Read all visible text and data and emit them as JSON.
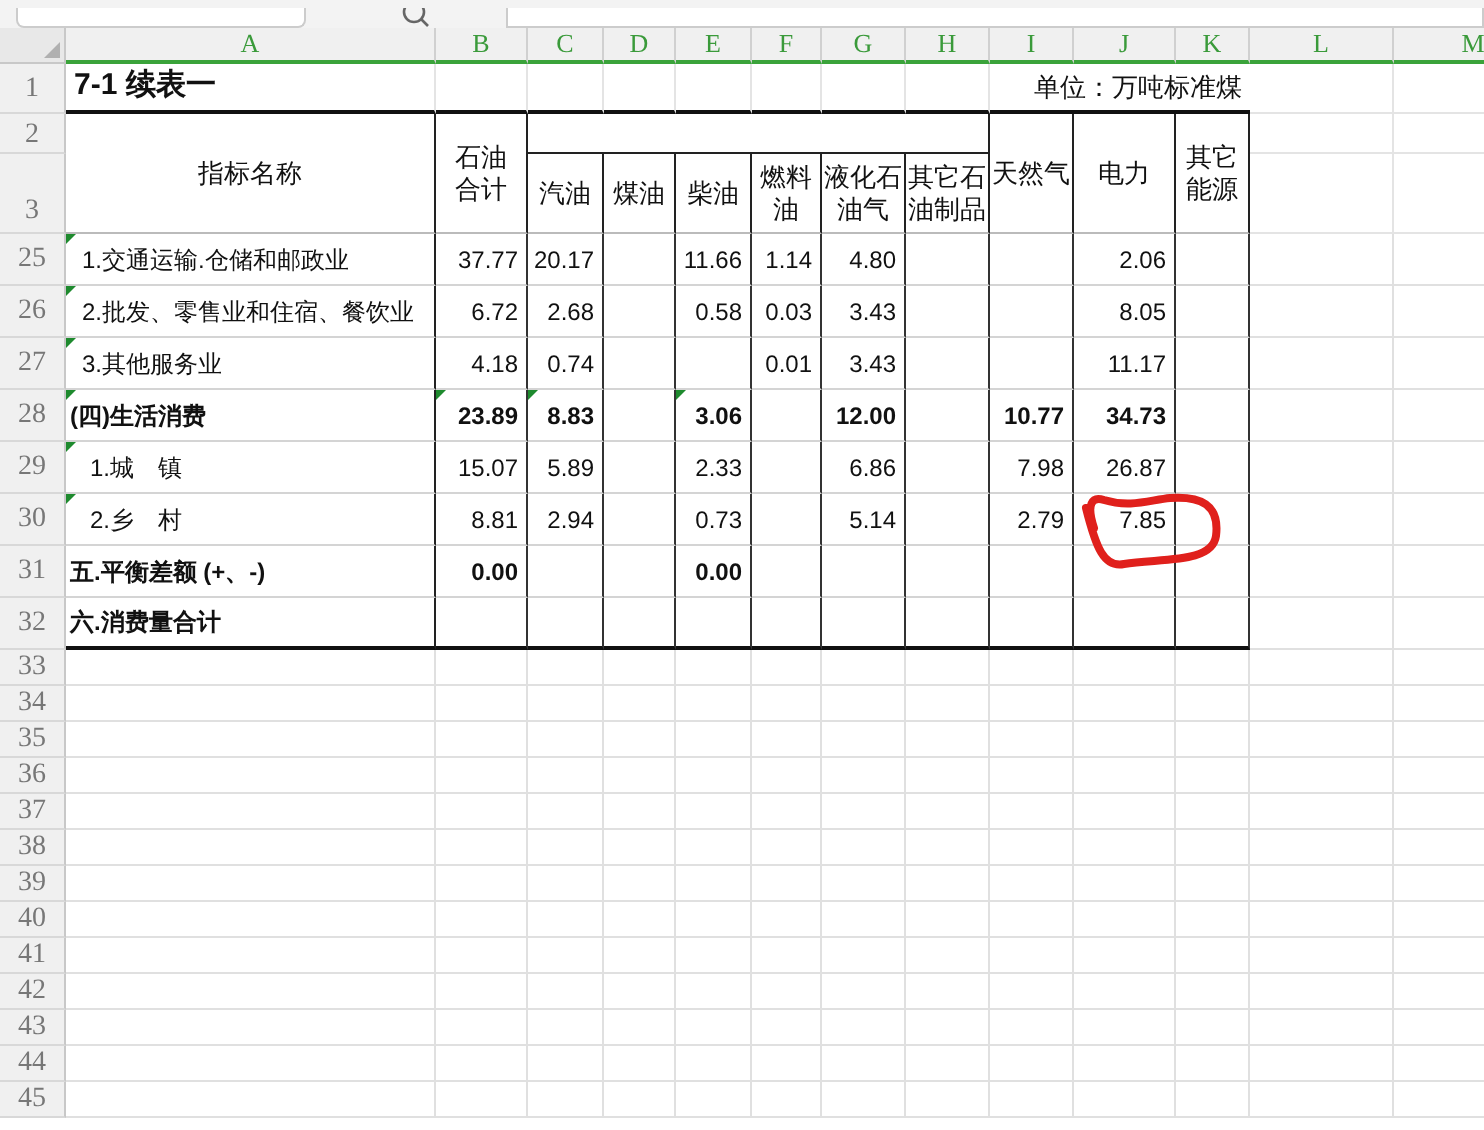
{
  "columns": [
    {
      "letter": "A"
    },
    {
      "letter": "B"
    },
    {
      "letter": "C"
    },
    {
      "letter": "D"
    },
    {
      "letter": "E"
    },
    {
      "letter": "F"
    },
    {
      "letter": "G"
    },
    {
      "letter": "H"
    },
    {
      "letter": "I"
    },
    {
      "letter": "J"
    },
    {
      "letter": "K"
    },
    {
      "letter": "L"
    },
    {
      "letter": "M"
    }
  ],
  "title": {
    "row": "1",
    "text": "7-1  续表一",
    "unit": "单位：万吨标准煤"
  },
  "header": {
    "rows": [
      "2",
      "3"
    ],
    "name": "指标名称",
    "total": "石油合计",
    "petroleum": [
      "汽油",
      "煤油",
      "柴油",
      "燃料油",
      "液化石油气",
      "其它石油制品"
    ],
    "others": [
      "天然气",
      "电力",
      "其它能源"
    ]
  },
  "rows": [
    {
      "row": "25",
      "kind": "item",
      "label": "1.交通运输.仓储和邮政业",
      "label_flagged": true,
      "values": {
        "B": "37.77",
        "C": "20.17",
        "E": "11.66",
        "F": "1.14",
        "G": "4.80",
        "J": "2.06"
      }
    },
    {
      "row": "26",
      "kind": "item",
      "label": "2.批发、零售业和住宿、餐饮业",
      "label_flagged": true,
      "values": {
        "B": "6.72",
        "C": "2.68",
        "E": "0.58",
        "F": "0.03",
        "G": "3.43",
        "J": "8.05"
      }
    },
    {
      "row": "27",
      "kind": "item",
      "label": "3.其他服务业",
      "label_flagged": true,
      "values": {
        "B": "4.18",
        "C": "0.74",
        "F": "0.01",
        "G": "3.43",
        "J": "11.17"
      }
    },
    {
      "row": "28",
      "kind": "group",
      "label": "(四)生活消费",
      "label_flagged": true,
      "values": {
        "B": "23.89",
        "C": "8.83",
        "E": "3.06",
        "G": "12.00",
        "I": "10.77",
        "J": "34.73"
      },
      "flagged_values": {
        "B": true,
        "C": true,
        "E": true
      }
    },
    {
      "row": "29",
      "kind": "subitem",
      "label": "1.城　镇",
      "label_flagged": true,
      "values": {
        "B": "15.07",
        "C": "5.89",
        "E": "2.33",
        "G": "6.86",
        "I": "7.98",
        "J": "26.87"
      }
    },
    {
      "row": "30",
      "kind": "subitem",
      "label": "2.乡　村",
      "label_flagged": true,
      "values": {
        "B": "8.81",
        "C": "2.94",
        "E": "0.73",
        "G": "5.14",
        "I": "2.79",
        "J": "7.85"
      }
    },
    {
      "row": "31",
      "kind": "group",
      "label": "五.平衡差额 (+、-)",
      "label_flagged": false,
      "values": {
        "B": "0.00",
        "E": "0.00"
      }
    },
    {
      "row": "32",
      "kind": "group",
      "label": "六.消费量合计",
      "label_flagged": false,
      "values": {}
    }
  ],
  "empty_rows": [
    "33",
    "34",
    "35",
    "36",
    "37",
    "38",
    "39",
    "40",
    "41",
    "42",
    "43",
    "44",
    "45"
  ]
}
